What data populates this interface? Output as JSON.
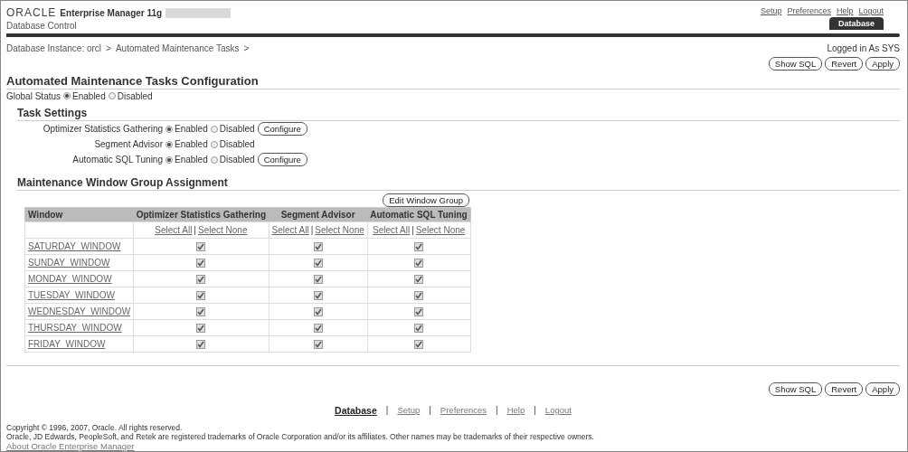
{
  "header": {
    "brand": "ORACLE",
    "product": "Enterprise Manager 11g",
    "subtitle": "Database Control",
    "global_links": [
      "Setup",
      "Preferences",
      "Help",
      "Logout"
    ],
    "tabs": [
      {
        "label": "Database",
        "selected": true
      }
    ]
  },
  "breadcrumb": {
    "items": [
      "Database Instance: orcl",
      "Automated Maintenance Tasks"
    ],
    "separator": ">"
  },
  "logged_in": "Logged in As SYS",
  "top_buttons": [
    "Show SQL",
    "Revert",
    "Apply"
  ],
  "title": "Automated Maintenance Tasks Configuration",
  "global_status": {
    "label": "Global Status",
    "options": [
      {
        "label": "Enabled",
        "selected": true
      },
      {
        "label": "Disabled",
        "selected": false
      }
    ]
  },
  "task_settings": {
    "heading": "Task Settings",
    "tasks": [
      {
        "name": "Optimizer Statistics Gathering",
        "options": [
          {
            "label": "Enabled",
            "selected": true
          },
          {
            "label": "Disabled",
            "selected": false
          }
        ],
        "button": "Configure"
      },
      {
        "name": "Segment Advisor",
        "options": [
          {
            "label": "Enabled",
            "selected": true
          },
          {
            "label": "Disabled",
            "selected": false
          }
        ]
      },
      {
        "name": "Automatic SQL Tuning",
        "options": [
          {
            "label": "Enabled",
            "selected": true
          },
          {
            "label": "Disabled",
            "selected": false
          }
        ],
        "button": "Configure"
      }
    ]
  },
  "window_groups": {
    "heading": "Maintenance Window Group Assignment",
    "edit_button": "Edit Window Group",
    "columns": [
      "Window",
      "Optimizer Statistics Gathering",
      "Segment Advisor",
      "Automatic SQL Tuning"
    ],
    "select_links": [
      {
        "all": "Select All",
        "separator": "|",
        "none": "Select None"
      },
      {
        "all": "Select All",
        "separator": "|",
        "none": "Select None"
      },
      {
        "all": "Select All",
        "separator": "|",
        "none": "Select None"
      }
    ],
    "rows": [
      {
        "window": "SATURDAY_WINDOW",
        "checked": [
          true,
          true,
          true
        ]
      },
      {
        "window": "SUNDAY_WINDOW",
        "checked": [
          true,
          true,
          true
        ]
      },
      {
        "window": "MONDAY_WINDOW",
        "checked": [
          true,
          true,
          true
        ]
      },
      {
        "window": "TUESDAY_WINDOW",
        "checked": [
          true,
          true,
          true
        ]
      },
      {
        "window": "WEDNESDAY_WINDOW",
        "checked": [
          true,
          true,
          true
        ]
      },
      {
        "window": "THURSDAY_WINDOW",
        "checked": [
          true,
          true,
          true
        ]
      },
      {
        "window": "FRIDAY_WINDOW",
        "checked": [
          true,
          true,
          true
        ]
      }
    ]
  },
  "bottom_buttons": [
    "Show SQL",
    "Revert",
    "Apply"
  ],
  "footer": {
    "links": [
      {
        "label": "Database",
        "selected": true
      },
      {
        "label": "Setup",
        "selected": false
      },
      {
        "label": "Preferences",
        "selected": false
      },
      {
        "label": "Help",
        "selected": false
      },
      {
        "label": "Logout",
        "selected": false
      }
    ],
    "separator": "|",
    "copyright": "Copyright © 1996, 2007, Oracle. All rights reserved.",
    "trademark": "Oracle, JD Edwards, PeopleSoft, and Retek are registered trademarks of Oracle Corporation and/or its affiliates. Other names may be trademarks of their respective owners.",
    "about": "About Oracle Enterprise Manager"
  }
}
